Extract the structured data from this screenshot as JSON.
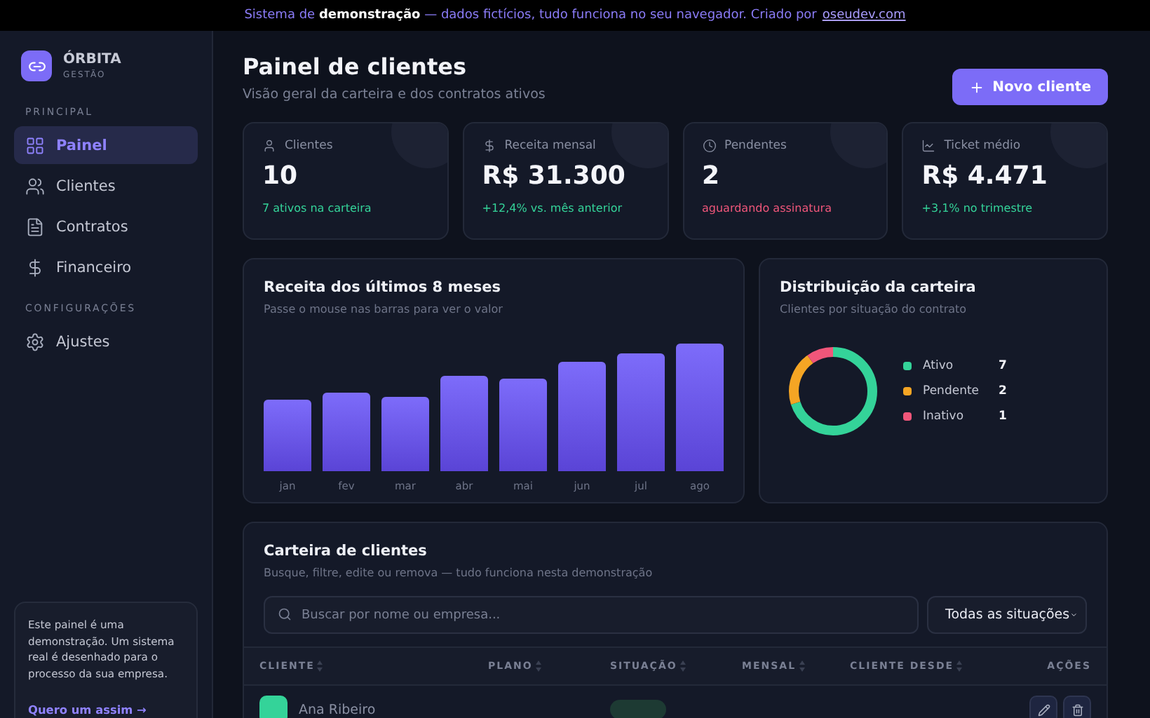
{
  "banner": {
    "text": "Sistema de **demonstração** — dados fictícios, tudo funciona no seu navegador. Criado por",
    "link": "oseudev.com"
  },
  "brand": {
    "name": "ÓRBITA",
    "tagline": "GESTÃO"
  },
  "sidebar": {
    "sections": [
      {
        "title": "PRINCIPAL",
        "items": [
          {
            "label": "Painel",
            "selected": true
          },
          {
            "label": "Clientes",
            "selected": false
          },
          {
            "label": "Contratos",
            "selected": false
          },
          {
            "label": "Financeiro",
            "selected": false
          }
        ]
      },
      {
        "title": "CONFIGURAÇÕES",
        "items": [
          {
            "label": "Ajustes",
            "selected": false
          }
        ]
      }
    ],
    "promo": {
      "text": "Este painel é uma demonstração. Um sistema real é desenhado para o processo da sua empresa.",
      "link": "Quero um assim →"
    }
  },
  "header": {
    "title": "Painel de clientes",
    "subtitle": "Visão geral da carteira e dos contratos ativos",
    "button": "Novo cliente"
  },
  "stats": [
    {
      "label": "Clientes",
      "value": "10",
      "note": "7 ativos na carteira",
      "alert": false
    },
    {
      "label": "Receita mensal",
      "value": "R$ 31.300",
      "note": "+12,4% vs. mês anterior",
      "alert": false
    },
    {
      "label": "Pendentes",
      "value": "2",
      "note": "aguardando assinatura",
      "alert": true
    },
    {
      "label": "Ticket médio",
      "value": "R$ 4.471",
      "note": "+3,1% no trimestre",
      "alert": false
    }
  ],
  "revenue": {
    "title": "Receita dos últimos 8 meses",
    "subtitle": "Passe o mouse nas barras para ver o valor",
    "months": [
      "jan",
      "fev",
      "mar",
      "abr",
      "mai",
      "jun",
      "jul",
      "ago"
    ]
  },
  "distribution": {
    "title": "Distribuição da carteira",
    "subtitle": "Clientes por situação do contrato",
    "legend": [
      {
        "label": "Ativo",
        "count": "7",
        "color": "#34d399"
      },
      {
        "label": "Pendente",
        "count": "2",
        "color": "#f5a524"
      },
      {
        "label": "Inativo",
        "count": "1",
        "color": "#f0567a"
      }
    ]
  },
  "portfolio": {
    "title": "Carteira de clientes",
    "subtitle": "Busque, filtre, edite ou remova — tudo funciona nesta demonstração",
    "search": {
      "placeholder": "Buscar por nome ou empresa..."
    },
    "filter": "Todas as situações",
    "columns": [
      {
        "label": "CLIENTE",
        "sortable": true
      },
      {
        "label": "PLANO",
        "sortable": true
      },
      {
        "label": "SITUAÇÃO",
        "sortable": true
      },
      {
        "label": "MENSAL",
        "sortable": true
      },
      {
        "label": "CLIENTE DESDE",
        "sortable": true
      },
      {
        "label": "AÇÕES",
        "sortable": false
      }
    ],
    "rows": [
      {
        "name": "Ana Ribeiro",
        "color": "#34d399"
      }
    ]
  }
}
